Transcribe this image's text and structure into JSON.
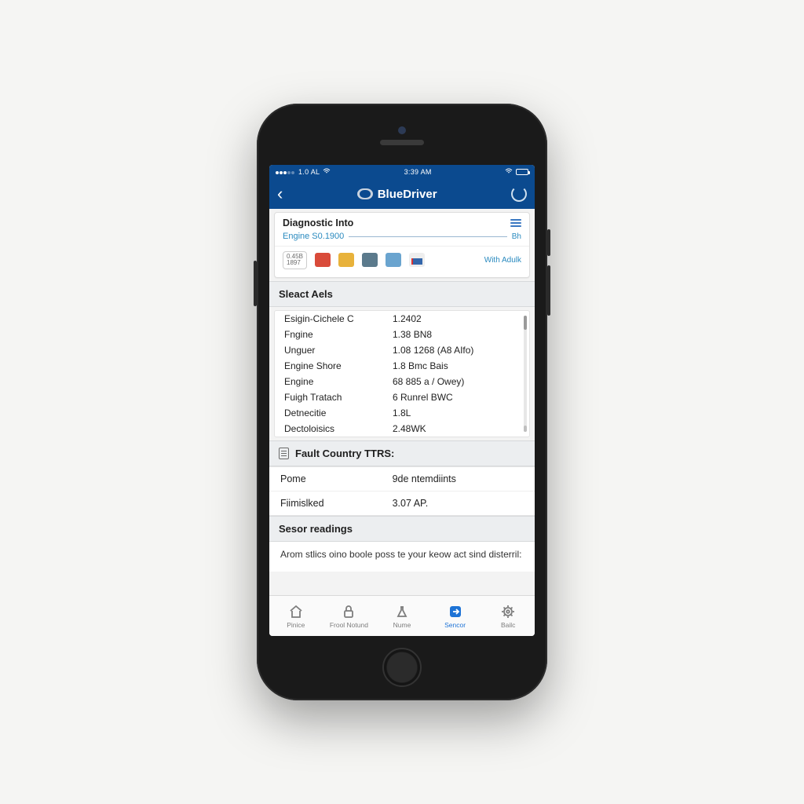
{
  "statusbar": {
    "carrier": "1.0 AL",
    "time": "3:39 AM"
  },
  "navbar": {
    "title": "BlueDriver"
  },
  "diag": {
    "title": "Diagnostic Into",
    "engine_label": "Engine S0.1900",
    "engine_cap": "Bh",
    "chip_line1": "0.45B",
    "chip_line2": "1897",
    "with_link": "With Adulk"
  },
  "sleact": {
    "title": "Sleact Aels",
    "rows": [
      {
        "k": "Esigin-Cichele C",
        "v": "1.2402"
      },
      {
        "k": "Fngine",
        "v": "1.38 BN8"
      },
      {
        "k": "Unguer",
        "v": "1.08 1268 (A8 AIfo)"
      },
      {
        "k": "Engine Shore",
        "v": "1.8 Bmc Bais"
      },
      {
        "k": "Engine",
        "v": "68 885 a / Owey)"
      },
      {
        "k": "Fuigh Tratach",
        "v": "6 Runrel BWC"
      },
      {
        "k": "Detnecitie",
        "v": "1.8L"
      },
      {
        "k": "Dectoloisics",
        "v": "2.48WK"
      }
    ]
  },
  "fault": {
    "title": "Fault Country TTRS:",
    "rows": [
      {
        "k": "Pome",
        "v": "9de ntemdiints"
      },
      {
        "k": "Fiimislked",
        "v": "3.07 AP."
      }
    ]
  },
  "sensor": {
    "title": "Sesor readings",
    "body": "Arom stlics oino boole poss te your keow act sind disterril:"
  },
  "tabs": [
    {
      "label": "Pinice"
    },
    {
      "label": "Frool Notund"
    },
    {
      "label": "Nume"
    },
    {
      "label": "Sencor"
    },
    {
      "label": "Bailc"
    }
  ]
}
